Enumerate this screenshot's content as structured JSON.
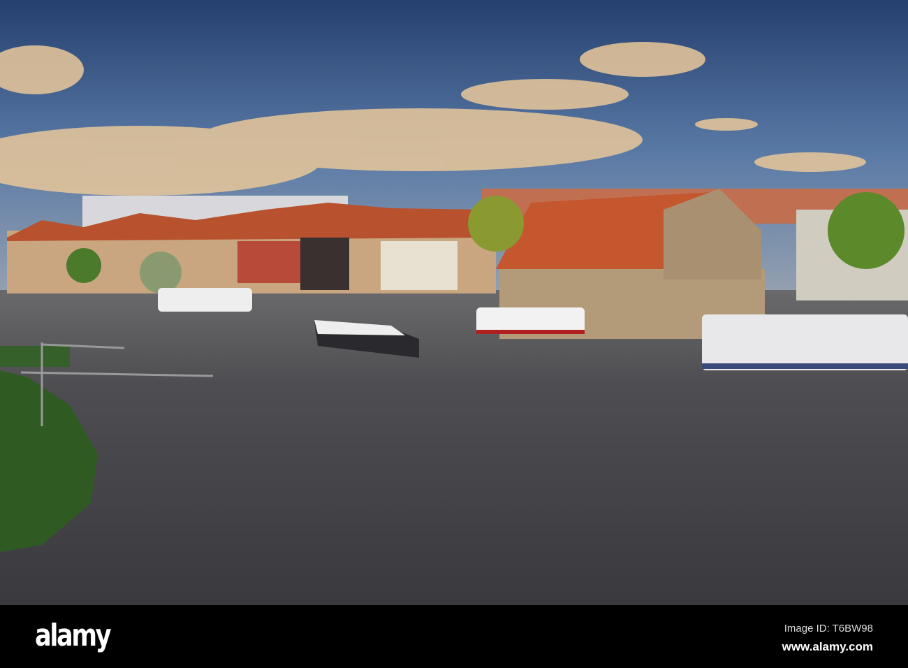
{
  "photo": {
    "subject": "Riverside town with half-timbered houses, boats on river",
    "colors": {
      "sky_top": "#2a4a7a",
      "sky_low": "#6d8bb0",
      "cloud": "#e8c898",
      "roof": "#c05a30",
      "water": "#4a4a4e",
      "bank": "#2f5a22"
    }
  },
  "watermark": {
    "logo": "alamy",
    "image_id": "Image ID: T6BW98",
    "url": "www.alamy.com"
  }
}
